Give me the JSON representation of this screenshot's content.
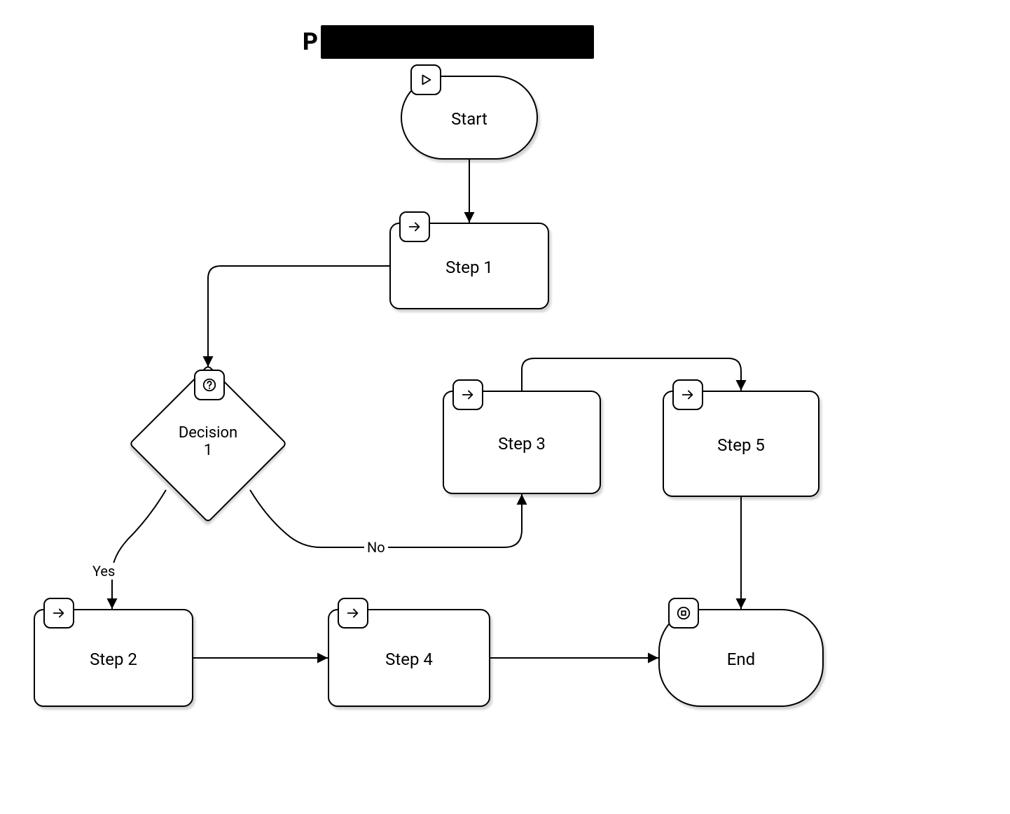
{
  "title": "P",
  "nodes": {
    "start": {
      "label": "Start"
    },
    "step1": {
      "label": "Step 1"
    },
    "decision": {
      "label": "Decision\n1"
    },
    "step2": {
      "label": "Step 2"
    },
    "step3": {
      "label": "Step 3"
    },
    "step4": {
      "label": "Step 4"
    },
    "step5": {
      "label": "Step 5"
    },
    "end": {
      "label": "End"
    }
  },
  "edgeLabels": {
    "decision_yes": "Yes",
    "decision_no": "No"
  },
  "icons": {
    "play": "play-icon",
    "arrow": "arrow-right-icon",
    "question": "question-icon",
    "stop": "stop-icon"
  }
}
